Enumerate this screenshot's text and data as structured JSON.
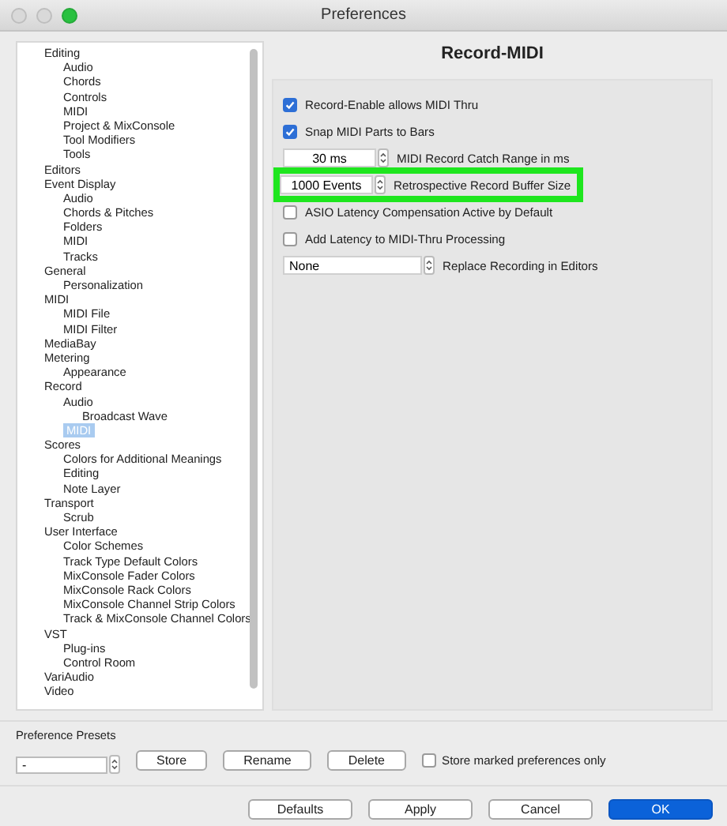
{
  "window": {
    "title": "Preferences"
  },
  "tree": [
    {
      "label": "Editing",
      "selected": false,
      "children": [
        {
          "label": "Audio",
          "selected": false
        },
        {
          "label": "Chords",
          "selected": false
        },
        {
          "label": "Controls",
          "selected": false
        },
        {
          "label": "MIDI",
          "selected": false
        },
        {
          "label": "Project & MixConsole",
          "selected": false
        },
        {
          "label": "Tool Modifiers",
          "selected": false
        },
        {
          "label": "Tools",
          "selected": false
        }
      ]
    },
    {
      "label": "Editors",
      "selected": false
    },
    {
      "label": "Event Display",
      "selected": false,
      "children": [
        {
          "label": "Audio",
          "selected": false
        },
        {
          "label": "Chords & Pitches",
          "selected": false
        },
        {
          "label": "Folders",
          "selected": false
        },
        {
          "label": "MIDI",
          "selected": false
        },
        {
          "label": "Tracks",
          "selected": false
        }
      ]
    },
    {
      "label": "General",
      "selected": false,
      "children": [
        {
          "label": "Personalization",
          "selected": false
        }
      ]
    },
    {
      "label": "MIDI",
      "selected": false,
      "children": [
        {
          "label": "MIDI File",
          "selected": false
        },
        {
          "label": "MIDI Filter",
          "selected": false
        }
      ]
    },
    {
      "label": "MediaBay",
      "selected": false
    },
    {
      "label": "Metering",
      "selected": false,
      "children": [
        {
          "label": "Appearance",
          "selected": false
        }
      ]
    },
    {
      "label": "Record",
      "selected": false,
      "children": [
        {
          "label": "Audio",
          "selected": false,
          "children": [
            {
              "label": "Broadcast Wave",
              "selected": false
            }
          ]
        },
        {
          "label": "MIDI",
          "selected": true
        }
      ]
    },
    {
      "label": "Scores",
      "selected": false,
      "children": [
        {
          "label": "Colors for Additional Meanings",
          "selected": false
        },
        {
          "label": "Editing",
          "selected": false
        },
        {
          "label": "Note Layer",
          "selected": false
        }
      ]
    },
    {
      "label": "Transport",
      "selected": false,
      "children": [
        {
          "label": "Scrub",
          "selected": false
        }
      ]
    },
    {
      "label": "User Interface",
      "selected": false,
      "children": [
        {
          "label": "Color Schemes",
          "selected": false
        },
        {
          "label": "Track Type Default Colors",
          "selected": false
        },
        {
          "label": "MixConsole Fader Colors",
          "selected": false
        },
        {
          "label": "MixConsole Rack Colors",
          "selected": false
        },
        {
          "label": "MixConsole Channel Strip Colors",
          "selected": false
        },
        {
          "label": "Track & MixConsole Channel Colors",
          "selected": false
        }
      ]
    },
    {
      "label": "VST",
      "selected": false,
      "children": [
        {
          "label": "Plug-ins",
          "selected": false
        },
        {
          "label": "Control Room",
          "selected": false
        }
      ]
    },
    {
      "label": "VariAudio",
      "selected": false
    },
    {
      "label": "Video",
      "selected": false
    }
  ],
  "page": {
    "title": "Record-MIDI",
    "settings": [
      {
        "kind": "checkbox",
        "caption": "Record-Enable allows MIDI Thru",
        "checked": true,
        "highlighted": false
      },
      {
        "kind": "checkbox",
        "caption": "Snap MIDI Parts to Bars",
        "checked": true,
        "highlighted": false
      },
      {
        "kind": "spin",
        "value": "30 ms",
        "caption": "MIDI Record Catch Range in ms",
        "highlighted": false
      },
      {
        "kind": "spin",
        "value": "1000 Events",
        "caption": "Retrospective Record Buffer Size",
        "highlighted": true
      },
      {
        "kind": "checkbox",
        "caption": "ASIO Latency Compensation Active by Default",
        "checked": false,
        "highlighted": false
      },
      {
        "kind": "checkbox",
        "caption": "Add Latency to MIDI-Thru Processing",
        "checked": false,
        "highlighted": false
      },
      {
        "kind": "dropdown",
        "value": "None",
        "caption": "Replace Recording in Editors",
        "highlighted": false
      }
    ]
  },
  "presets": {
    "label": "Preference Presets",
    "value": "-",
    "buttons": [
      "Store",
      "Rename",
      "Delete"
    ],
    "store_marked": {
      "label": "Store marked preferences only",
      "checked": false
    }
  },
  "buttons": [
    {
      "label": "Defaults",
      "primary": false
    },
    {
      "label": "Apply",
      "primary": false
    },
    {
      "label": "Cancel",
      "primary": false
    },
    {
      "label": "OK",
      "primary": true
    }
  ]
}
